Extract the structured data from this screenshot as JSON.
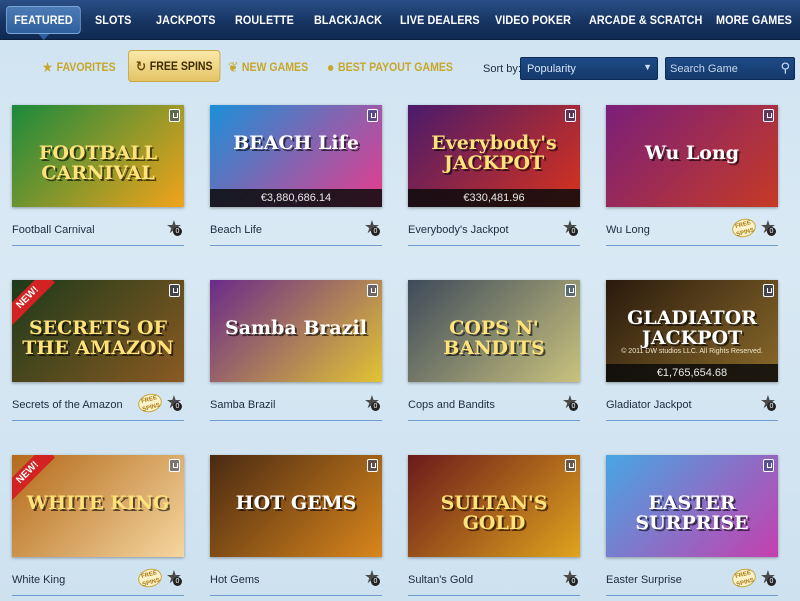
{
  "nav": {
    "tabs": [
      {
        "label": "Featured",
        "active": true
      },
      {
        "label": "Slots"
      },
      {
        "label": "Jackpots"
      },
      {
        "label": "Roulette"
      },
      {
        "label": "Blackjack"
      },
      {
        "label": "Live Dealers"
      },
      {
        "label": "Video Poker"
      },
      {
        "label": "Arcade & Scratch"
      },
      {
        "label": "More Games"
      }
    ]
  },
  "filters": [
    {
      "label": "Favorites",
      "icon": "star-icon"
    },
    {
      "label": "Free Spins",
      "icon": "refresh-icon",
      "active": true
    },
    {
      "label": "New Games",
      "icon": "leaf-icon"
    },
    {
      "label": "Best Payout Games",
      "icon": "coins-icon"
    }
  ],
  "sort": {
    "label": "Sort by:",
    "selected": "Popularity"
  },
  "search": {
    "placeholder": "Search Game",
    "value": ""
  },
  "colors": {
    "nav": "#173563",
    "accent": "#c7a62a",
    "link_line": "#6f9ccc"
  },
  "games": [
    {
      "name": "Football Carnival",
      "art_text": "FOOTBALL CARNIVAL",
      "colors": [
        "#1a8a3c",
        "#f2a31b"
      ],
      "free_spins": false,
      "new": false,
      "jackpot": ""
    },
    {
      "name": "Beach Life",
      "art_text": "BEACH Life",
      "colors": [
        "#1b8fd8",
        "#e93b8c"
      ],
      "free_spins": false,
      "new": false,
      "jackpot": "€3,880,686.14"
    },
    {
      "name": "Everybody's Jackpot",
      "art_text": "Everybody's JACKPOT",
      "colors": [
        "#4a1b6b",
        "#d9321c"
      ],
      "free_spins": false,
      "new": false,
      "jackpot": "€330,481.96"
    },
    {
      "name": "Wu Long",
      "art_text": "Wu Long",
      "colors": [
        "#7a1f7a",
        "#c63a25"
      ],
      "free_spins": true,
      "new": false,
      "jackpot": ""
    },
    {
      "name": "Secrets of the Amazon",
      "art_text": "SECRETS OF THE AMAZON",
      "colors": [
        "#1d3a1a",
        "#8a5a22"
      ],
      "free_spins": true,
      "new": true,
      "jackpot": ""
    },
    {
      "name": "Samba Brazil",
      "art_text": "Samba Brazil",
      "colors": [
        "#6a2a8a",
        "#e2c333"
      ],
      "free_spins": false,
      "new": false,
      "jackpot": ""
    },
    {
      "name": "Cops and Bandits",
      "art_text": "COPS N' BANDITS",
      "colors": [
        "#3d4a5a",
        "#c9c27e"
      ],
      "free_spins": false,
      "new": false,
      "jackpot": ""
    },
    {
      "name": "Gladiator Jackpot",
      "art_text": "GLADIATOR JACKPOT",
      "colors": [
        "#2a1a0d",
        "#8a6a2a"
      ],
      "free_spins": false,
      "new": false,
      "jackpot": "€1,765,654.68",
      "caption": "© 2011 DW studios LLC. All Rights Reserved."
    },
    {
      "name": "White King",
      "art_text": "WHITE KING",
      "colors": [
        "#b36a1a",
        "#f5d6a0"
      ],
      "free_spins": true,
      "new": true,
      "jackpot": ""
    },
    {
      "name": "Hot Gems",
      "art_text": "HOT GEMS",
      "colors": [
        "#4a2a12",
        "#d9861c"
      ],
      "free_spins": false,
      "new": false,
      "jackpot": ""
    },
    {
      "name": "Sultan's Gold",
      "art_text": "SULTAN'S GOLD",
      "colors": [
        "#6a1a1a",
        "#e0a31d"
      ],
      "free_spins": false,
      "new": false,
      "jackpot": ""
    },
    {
      "name": "Easter Surprise",
      "art_text": "EASTER SURPRISE",
      "colors": [
        "#47a6e3",
        "#c53fae"
      ],
      "free_spins": true,
      "new": false,
      "jackpot": ""
    }
  ],
  "labels": {
    "new_badge": "NEW!",
    "free_spins_badge": "FREE SPINS",
    "star_count": "0"
  }
}
